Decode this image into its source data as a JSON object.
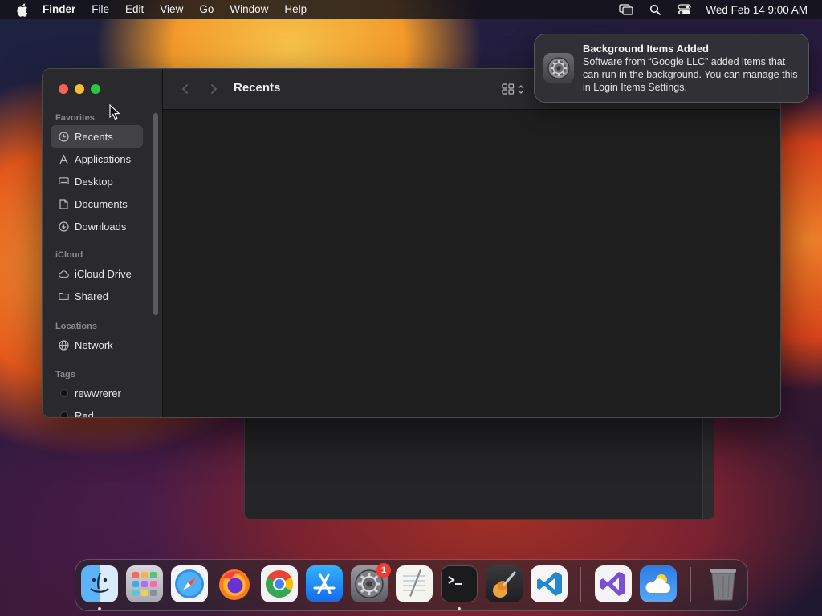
{
  "menubar": {
    "apple_icon": "apple-logo-icon",
    "items": [
      "Finder",
      "File",
      "Edit",
      "View",
      "Go",
      "Window",
      "Help"
    ],
    "clock": "Wed Feb 14  9:00 AM",
    "right_icons": [
      "screen-mirroring-icon",
      "search-icon",
      "control-center-icon"
    ]
  },
  "finder": {
    "title": "Recents",
    "sidebar": {
      "favorites_heading": "Favorites",
      "favorites": [
        {
          "label": "Recents",
          "icon": "clock-icon"
        },
        {
          "label": "Applications",
          "icon": "applications-icon"
        },
        {
          "label": "Desktop",
          "icon": "desktop-icon"
        },
        {
          "label": "Documents",
          "icon": "document-icon"
        },
        {
          "label": "Downloads",
          "icon": "download-icon"
        }
      ],
      "icloud_heading": "iCloud",
      "icloud": [
        {
          "label": "iCloud Drive",
          "icon": "cloud-icon"
        },
        {
          "label": "Shared",
          "icon": "shared-folder-icon"
        }
      ],
      "locations_heading": "Locations",
      "locations": [
        {
          "label": "Network",
          "icon": "globe-icon"
        }
      ],
      "tags_heading": "Tags",
      "tags": [
        {
          "label": "rewwrerer",
          "color": "#111111"
        },
        {
          "label": "Red",
          "color": "#111111"
        }
      ]
    }
  },
  "notification": {
    "title": "Background Items Added",
    "body": "Software from “Google LLC” added items that can run in the background. You can manage this in Login Items Settings.",
    "icon": "system-settings-gear-icon"
  },
  "dock": {
    "apps": [
      "Finder",
      "Launchpad",
      "Safari",
      "Firefox",
      "Google Chrome",
      "App Store",
      "System Settings",
      "TextEdit",
      "Terminal",
      "GarageBand",
      "Visual Studio Code",
      "Visual Studio",
      "Weather",
      "Trash"
    ],
    "settings_badge": "1"
  },
  "colors": {
    "accent_red": "#fe5f57",
    "accent_yellow": "#febc2e",
    "accent_green": "#28c840",
    "badge": "#f23a30"
  }
}
